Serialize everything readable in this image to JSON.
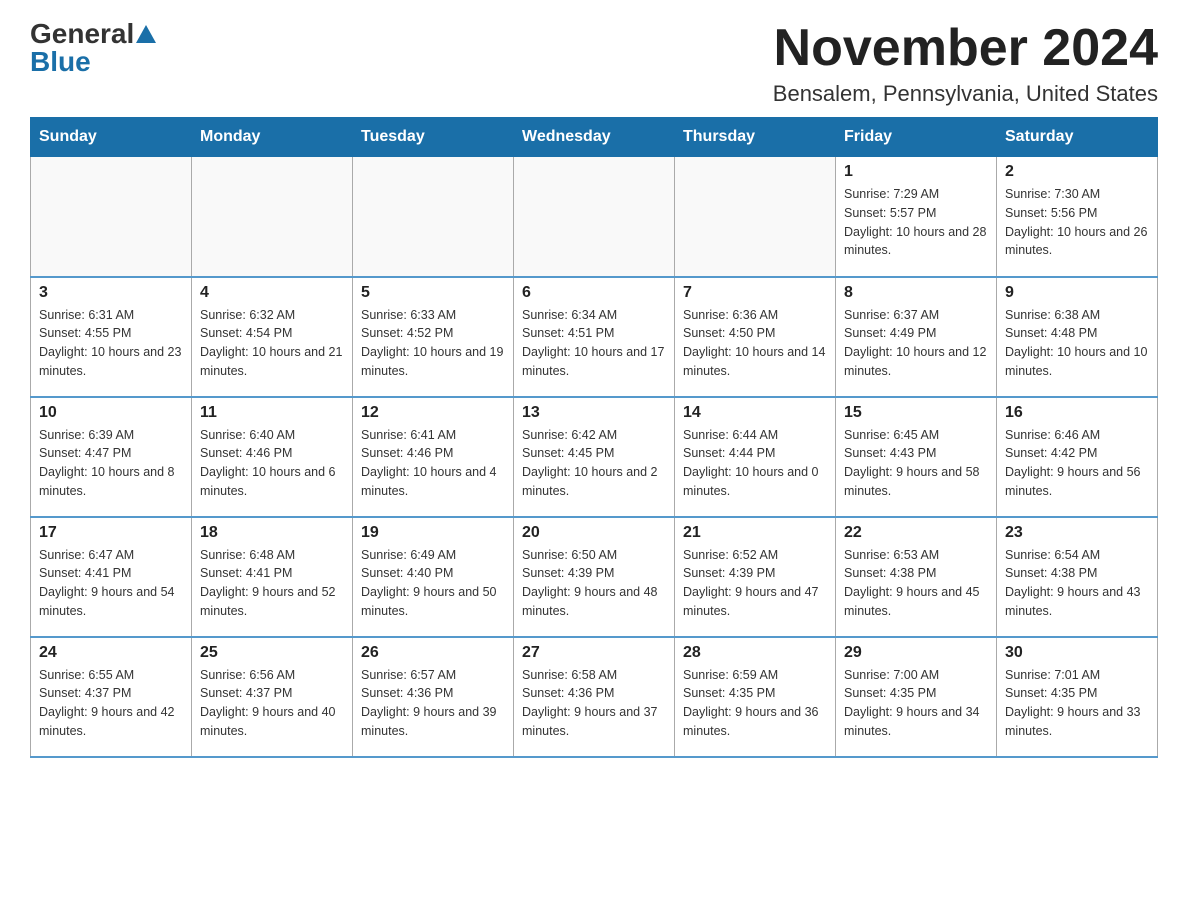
{
  "header": {
    "logo_general": "General",
    "logo_blue": "Blue",
    "month_title": "November 2024",
    "location": "Bensalem, Pennsylvania, United States"
  },
  "weekdays": [
    "Sunday",
    "Monday",
    "Tuesday",
    "Wednesday",
    "Thursday",
    "Friday",
    "Saturday"
  ],
  "weeks": [
    [
      {
        "day": "",
        "info": ""
      },
      {
        "day": "",
        "info": ""
      },
      {
        "day": "",
        "info": ""
      },
      {
        "day": "",
        "info": ""
      },
      {
        "day": "",
        "info": ""
      },
      {
        "day": "1",
        "info": "Sunrise: 7:29 AM\nSunset: 5:57 PM\nDaylight: 10 hours and 28 minutes."
      },
      {
        "day": "2",
        "info": "Sunrise: 7:30 AM\nSunset: 5:56 PM\nDaylight: 10 hours and 26 minutes."
      }
    ],
    [
      {
        "day": "3",
        "info": "Sunrise: 6:31 AM\nSunset: 4:55 PM\nDaylight: 10 hours and 23 minutes."
      },
      {
        "day": "4",
        "info": "Sunrise: 6:32 AM\nSunset: 4:54 PM\nDaylight: 10 hours and 21 minutes."
      },
      {
        "day": "5",
        "info": "Sunrise: 6:33 AM\nSunset: 4:52 PM\nDaylight: 10 hours and 19 minutes."
      },
      {
        "day": "6",
        "info": "Sunrise: 6:34 AM\nSunset: 4:51 PM\nDaylight: 10 hours and 17 minutes."
      },
      {
        "day": "7",
        "info": "Sunrise: 6:36 AM\nSunset: 4:50 PM\nDaylight: 10 hours and 14 minutes."
      },
      {
        "day": "8",
        "info": "Sunrise: 6:37 AM\nSunset: 4:49 PM\nDaylight: 10 hours and 12 minutes."
      },
      {
        "day": "9",
        "info": "Sunrise: 6:38 AM\nSunset: 4:48 PM\nDaylight: 10 hours and 10 minutes."
      }
    ],
    [
      {
        "day": "10",
        "info": "Sunrise: 6:39 AM\nSunset: 4:47 PM\nDaylight: 10 hours and 8 minutes."
      },
      {
        "day": "11",
        "info": "Sunrise: 6:40 AM\nSunset: 4:46 PM\nDaylight: 10 hours and 6 minutes."
      },
      {
        "day": "12",
        "info": "Sunrise: 6:41 AM\nSunset: 4:46 PM\nDaylight: 10 hours and 4 minutes."
      },
      {
        "day": "13",
        "info": "Sunrise: 6:42 AM\nSunset: 4:45 PM\nDaylight: 10 hours and 2 minutes."
      },
      {
        "day": "14",
        "info": "Sunrise: 6:44 AM\nSunset: 4:44 PM\nDaylight: 10 hours and 0 minutes."
      },
      {
        "day": "15",
        "info": "Sunrise: 6:45 AM\nSunset: 4:43 PM\nDaylight: 9 hours and 58 minutes."
      },
      {
        "day": "16",
        "info": "Sunrise: 6:46 AM\nSunset: 4:42 PM\nDaylight: 9 hours and 56 minutes."
      }
    ],
    [
      {
        "day": "17",
        "info": "Sunrise: 6:47 AM\nSunset: 4:41 PM\nDaylight: 9 hours and 54 minutes."
      },
      {
        "day": "18",
        "info": "Sunrise: 6:48 AM\nSunset: 4:41 PM\nDaylight: 9 hours and 52 minutes."
      },
      {
        "day": "19",
        "info": "Sunrise: 6:49 AM\nSunset: 4:40 PM\nDaylight: 9 hours and 50 minutes."
      },
      {
        "day": "20",
        "info": "Sunrise: 6:50 AM\nSunset: 4:39 PM\nDaylight: 9 hours and 48 minutes."
      },
      {
        "day": "21",
        "info": "Sunrise: 6:52 AM\nSunset: 4:39 PM\nDaylight: 9 hours and 47 minutes."
      },
      {
        "day": "22",
        "info": "Sunrise: 6:53 AM\nSunset: 4:38 PM\nDaylight: 9 hours and 45 minutes."
      },
      {
        "day": "23",
        "info": "Sunrise: 6:54 AM\nSunset: 4:38 PM\nDaylight: 9 hours and 43 minutes."
      }
    ],
    [
      {
        "day": "24",
        "info": "Sunrise: 6:55 AM\nSunset: 4:37 PM\nDaylight: 9 hours and 42 minutes."
      },
      {
        "day": "25",
        "info": "Sunrise: 6:56 AM\nSunset: 4:37 PM\nDaylight: 9 hours and 40 minutes."
      },
      {
        "day": "26",
        "info": "Sunrise: 6:57 AM\nSunset: 4:36 PM\nDaylight: 9 hours and 39 minutes."
      },
      {
        "day": "27",
        "info": "Sunrise: 6:58 AM\nSunset: 4:36 PM\nDaylight: 9 hours and 37 minutes."
      },
      {
        "day": "28",
        "info": "Sunrise: 6:59 AM\nSunset: 4:35 PM\nDaylight: 9 hours and 36 minutes."
      },
      {
        "day": "29",
        "info": "Sunrise: 7:00 AM\nSunset: 4:35 PM\nDaylight: 9 hours and 34 minutes."
      },
      {
        "day": "30",
        "info": "Sunrise: 7:01 AM\nSunset: 4:35 PM\nDaylight: 9 hours and 33 minutes."
      }
    ]
  ]
}
